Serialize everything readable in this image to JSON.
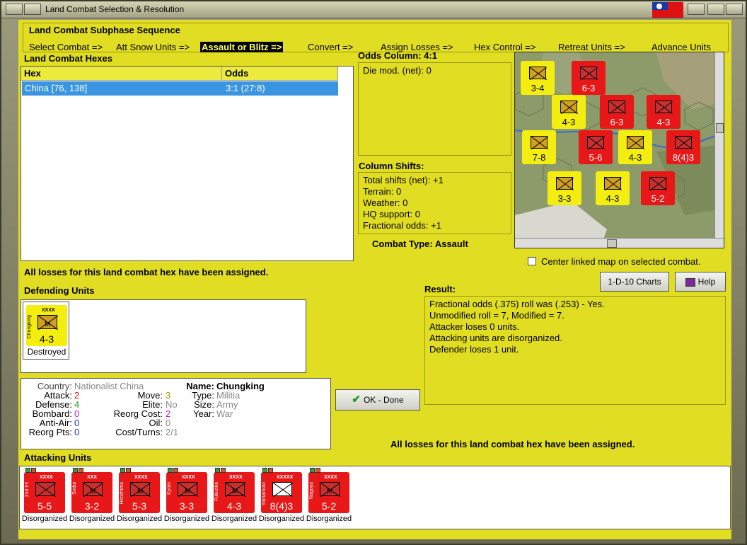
{
  "window": {
    "title": "Land Combat Selection & Resolution"
  },
  "sequence": {
    "title": "Land Combat Subphase Sequence",
    "steps": [
      "Select Combat =>",
      "Att Snow Units =>",
      "Assault or Blitz =>",
      "Convert =>",
      "Assign Losses =>",
      "Hex Control =>",
      "Retreat Units =>",
      "Advance Units"
    ],
    "active_index": 2
  },
  "hexes": {
    "title": "Land Combat Hexes",
    "columns": [
      "Hex",
      "Odds"
    ],
    "rows": [
      {
        "hex": "China [76, 138]",
        "odds": "3:1 (27:8)"
      }
    ]
  },
  "odds_column": {
    "title": "Odds Column: 4:1",
    "lines": [
      "Die mod. (net): 0"
    ]
  },
  "column_shifts": {
    "title": "Column Shifts:",
    "lines": [
      "Total shifts (net): +1",
      "Terrain: 0",
      "Weather: 0",
      "HQ support: 0",
      "Fractional odds: +1"
    ]
  },
  "combat_type": "Combat Type:  Assault",
  "center_map_label": "Center linked map on selected combat.",
  "losses_msg_top": "All losses for this land combat hex have been assigned.",
  "losses_msg_bottom": "All losses for this land combat hex have been assigned.",
  "buttons": {
    "charts": "1-D-10 Charts",
    "help": "Help",
    "ok": "OK - Done"
  },
  "result": {
    "title": "Result:",
    "lines": [
      "Fractional odds (.375) roll was (.253)  - Yes.",
      "Unmodified roll = 7, Modified = 7.",
      "Attacker loses 0 units.",
      "Attacking units are disorganized.",
      "Defender loses 1 unit."
    ]
  },
  "defending": {
    "title": "Defending Units",
    "units": [
      {
        "name": "Chungking",
        "size_tag": "XXXX",
        "strength": "4-3",
        "status": "Destroyed"
      }
    ]
  },
  "details": {
    "country_label": "Country:",
    "country": "Nationalist China",
    "attack_label": "Attack:",
    "attack": "2",
    "defense_label": "Defense:",
    "defense": "4",
    "bombard_label": "Bombard:",
    "bombard": "0",
    "antiair_label": "Anti-Air:",
    "antiair": "0",
    "reorgpts_label": "Reorg Pts:",
    "reorgpts": "0",
    "move_label": "Move:",
    "move": "3",
    "elite_label": "Elite:",
    "elite": "No",
    "reorgcost_label": "Reorg Cost:",
    "reorgcost": "2",
    "oil_label": "Oil:",
    "oil": "0",
    "costturns_label": "Cost/Turns:",
    "costturns": "2/1",
    "name_label": "Name:",
    "name": "Chungking",
    "type_label": "Type:",
    "type": "Militia",
    "size_label": "Size:",
    "size": "Army",
    "year_label": "Year:",
    "year": "War"
  },
  "attacking": {
    "title": "Attacking Units",
    "units": [
      {
        "name": "2nd Inf",
        "size_tag": "XXXX",
        "strength": "5-5",
        "status": "Disorganized",
        "symbol": "inf"
      },
      {
        "name": "Sodai",
        "size_tag": "XXX",
        "strength": "3-2",
        "status": "Disorganized",
        "symbol": "mil"
      },
      {
        "name": "Hiroshima",
        "size_tag": "XXXX",
        "strength": "5-3",
        "status": "Disorganized",
        "symbol": "mil"
      },
      {
        "name": "Kyoto",
        "size_tag": "XXXX",
        "strength": "3-3",
        "status": "Disorganized",
        "symbol": "mil"
      },
      {
        "name": "Fukuoka",
        "size_tag": "XXXX",
        "strength": "4-3",
        "status": "Disorganized",
        "symbol": "mil"
      },
      {
        "name": "Yamamoto",
        "size_tag": "XXXXX",
        "strength": "8(4)3",
        "status": "Disorganized",
        "symbol": "hq"
      },
      {
        "name": "Nagoya",
        "size_tag": "XXXX",
        "strength": "5-2",
        "status": "Disorganized",
        "symbol": "mil"
      }
    ]
  },
  "map_units": [
    {
      "strength": "3-4",
      "color": "yellow"
    },
    {
      "strength": "6-3",
      "color": "red"
    },
    {
      "strength": "4-3",
      "color": "yellow"
    },
    {
      "strength": "6-3",
      "color": "red"
    },
    {
      "strength": "4-3",
      "color": "red"
    },
    {
      "strength": "7-8",
      "color": "yellow"
    },
    {
      "strength": "5-6",
      "color": "red"
    },
    {
      "strength": "4-3",
      "color": "yellow"
    },
    {
      "strength": "8(4)3",
      "color": "red"
    },
    {
      "strength": "3-3",
      "color": "yellow"
    },
    {
      "strength": "4-3",
      "color": "yellow"
    },
    {
      "strength": "5-2",
      "color": "red"
    }
  ],
  "colors": {
    "panel_yellow": "#e1dd22",
    "selected_row": "#3a95e0",
    "japan_red": "#e81818",
    "china_yellow": "#f4ee10"
  },
  "icons": [
    "flag-icon",
    "help-book-icon",
    "checkmark-icon"
  ]
}
